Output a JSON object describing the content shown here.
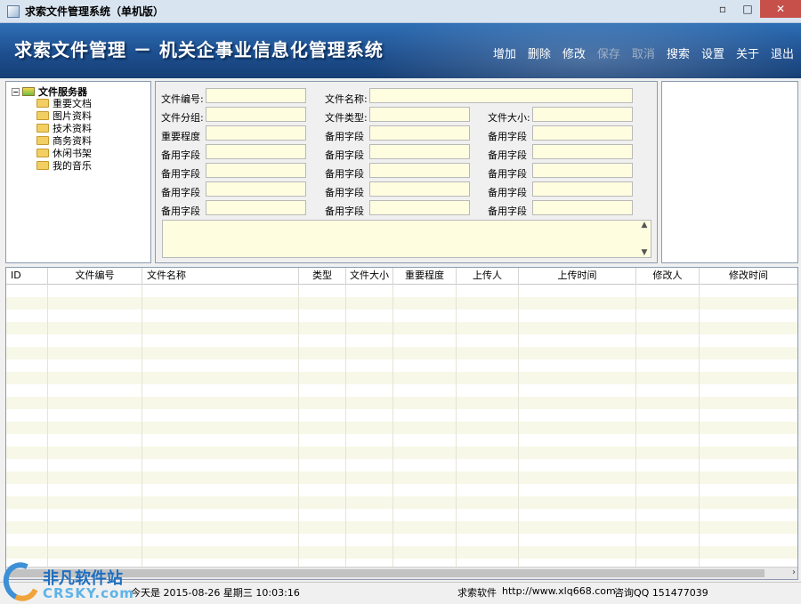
{
  "window": {
    "title": "求索文件管理系统（单机版）",
    "minimize": "▫",
    "maximize": "□",
    "close": "✕"
  },
  "banner": {
    "title": "求索文件管理 － 机关企事业信息化管理系统"
  },
  "menu": [
    {
      "label": "增加",
      "enabled": true
    },
    {
      "label": "删除",
      "enabled": true
    },
    {
      "label": "修改",
      "enabled": true
    },
    {
      "label": "保存",
      "enabled": false
    },
    {
      "label": "取消",
      "enabled": false
    },
    {
      "label": "搜索",
      "enabled": true
    },
    {
      "label": "设置",
      "enabled": true
    },
    {
      "label": "关于",
      "enabled": true
    },
    {
      "label": "退出",
      "enabled": true
    }
  ],
  "tree": {
    "root": "文件服务器",
    "expander": "−",
    "items": [
      "重要文档",
      "图片资料",
      "技术资料",
      "商务资料",
      "休闲书架",
      "我的音乐"
    ]
  },
  "form": {
    "file_no": "文件编号:",
    "file_name": "文件名称:",
    "file_group": "文件分组:",
    "file_type": "文件类型:",
    "file_size": "文件大小:",
    "importance": "重要程度",
    "spare": "备用字段"
  },
  "grid": {
    "columns": [
      "ID",
      "文件编号",
      "文件名称",
      "类型",
      "文件大小",
      "重要程度",
      "上传人",
      "上传时间",
      "修改人",
      "修改时间"
    ],
    "rows": []
  },
  "status": {
    "date": "今天是 2015-08-26 星期三 10:03:16",
    "company": "求索软件",
    "url": "http://www.xlq668.com",
    "qq": "咨询QQ 151477039"
  },
  "watermark": {
    "cn": "非凡软件站",
    "en": "CRSKY.com"
  }
}
